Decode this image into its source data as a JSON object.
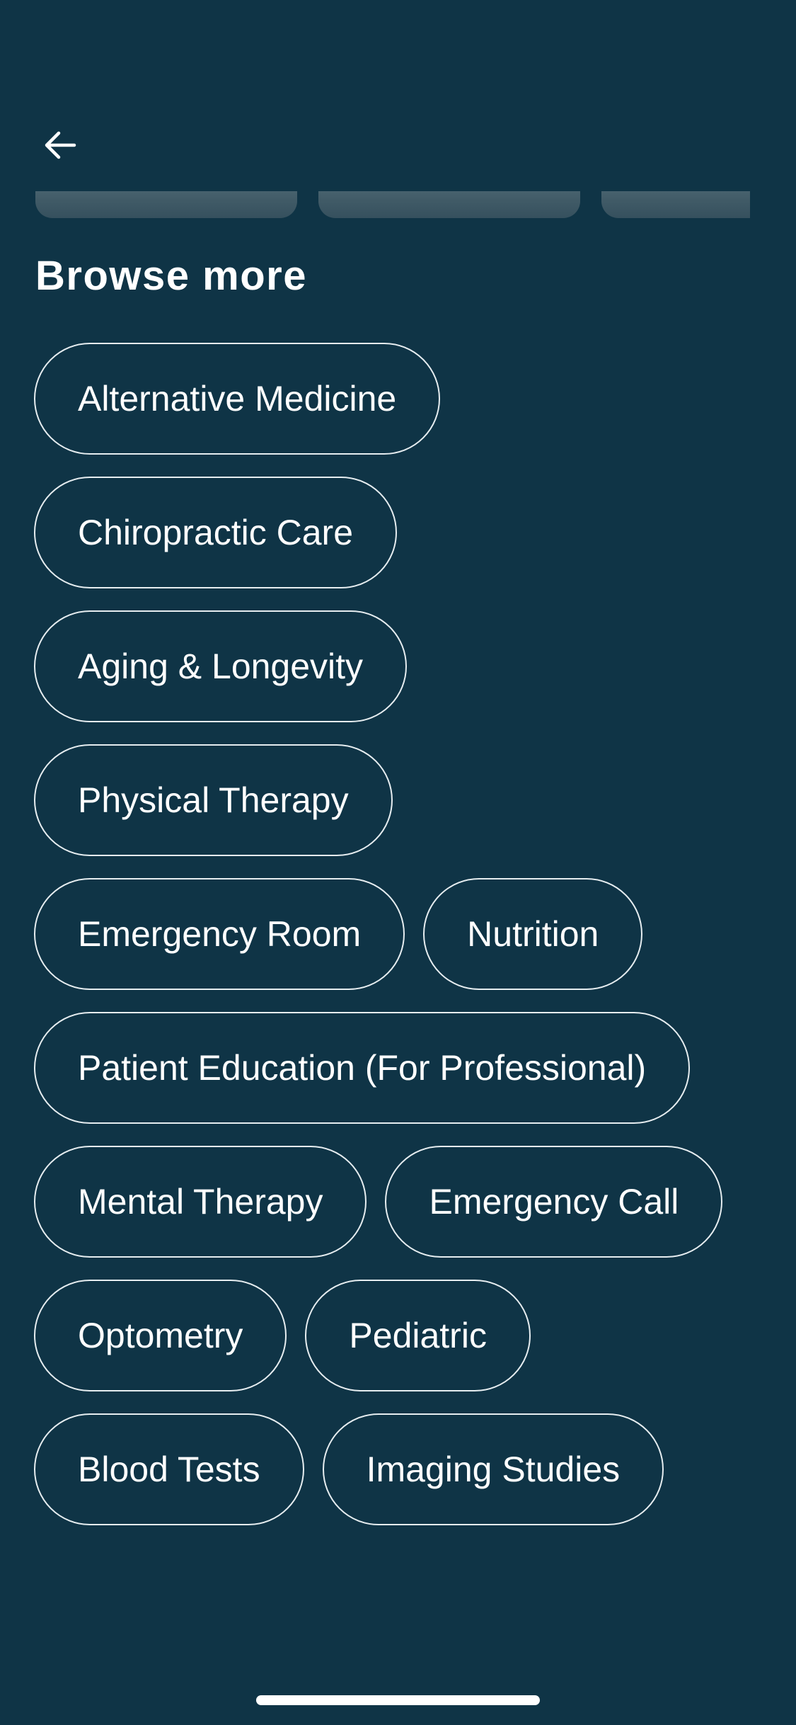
{
  "section": {
    "title": "Browse more"
  },
  "categories": [
    "Alternative Medicine",
    "Chiropractic Care",
    "Aging & Longevity",
    "Physical Therapy",
    "Emergency Room",
    "Nutrition",
    "Patient Education (For Professional)",
    "Mental Therapy",
    "Emergency Call",
    "Optometry",
    "Pediatric",
    "Blood Tests",
    "Imaging Studies"
  ],
  "icons": {
    "back": "arrow-left-icon"
  },
  "colors": {
    "background": "#0f3446",
    "text": "#ffffff",
    "chip_border": "#e6edf0"
  }
}
